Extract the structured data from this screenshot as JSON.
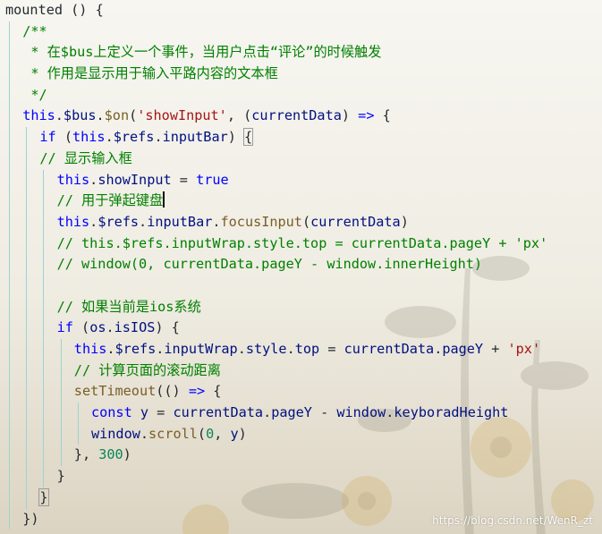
{
  "editor": {
    "theme": {
      "keyword": "#0000ff",
      "function": "#795e26",
      "string": "#a31515",
      "number": "#098658",
      "property": "#001080",
      "comment": "#008000",
      "text": "#24292e",
      "indent_guide": "#9dd3d2"
    },
    "cursor_line": 9,
    "lines": [
      {
        "indent": 0,
        "tokens": [
          [
            "plain",
            "mounted () {"
          ]
        ]
      },
      {
        "indent": 1,
        "tokens": [
          [
            "com",
            "/**"
          ]
        ]
      },
      {
        "indent": 1,
        "tokens": [
          [
            "com",
            " * 在$bus上定义一个事件，当用户点击“评论”的时候触发"
          ]
        ]
      },
      {
        "indent": 1,
        "tokens": [
          [
            "com",
            " * 作用是显示用于输入平路内容的文本框"
          ]
        ]
      },
      {
        "indent": 1,
        "tokens": [
          [
            "com",
            " */"
          ]
        ]
      },
      {
        "indent": 1,
        "tokens": [
          [
            "kw",
            "this"
          ],
          [
            "plain",
            "."
          ],
          [
            "prop",
            "$bus"
          ],
          [
            "plain",
            "."
          ],
          [
            "fn",
            "$on"
          ],
          [
            "plain",
            "("
          ],
          [
            "str",
            "'showInput'"
          ],
          [
            "plain",
            ", ("
          ],
          [
            "prop",
            "currentData"
          ],
          [
            "plain",
            ") "
          ],
          [
            "kw",
            "=>"
          ],
          [
            "plain",
            " {"
          ]
        ]
      },
      {
        "indent": 2,
        "tokens": [
          [
            "kw",
            "if"
          ],
          [
            "plain",
            " ("
          ],
          [
            "kw",
            "this"
          ],
          [
            "plain",
            "."
          ],
          [
            "prop",
            "$refs"
          ],
          [
            "plain",
            "."
          ],
          [
            "prop",
            "inputBar"
          ],
          [
            "plain",
            ") "
          ],
          [
            "box",
            "{"
          ]
        ]
      },
      {
        "indent": 2,
        "tokens": [
          [
            "com",
            "// 显示输入框"
          ]
        ]
      },
      {
        "indent": 3,
        "tokens": [
          [
            "kw",
            "this"
          ],
          [
            "plain",
            "."
          ],
          [
            "prop",
            "showInput"
          ],
          [
            "plain",
            " = "
          ],
          [
            "kw",
            "true"
          ]
        ]
      },
      {
        "indent": 3,
        "tokens": [
          [
            "com",
            "// 用于弹起键盘"
          ],
          [
            "cursor",
            ""
          ]
        ]
      },
      {
        "indent": 3,
        "tokens": [
          [
            "kw",
            "this"
          ],
          [
            "plain",
            "."
          ],
          [
            "prop",
            "$refs"
          ],
          [
            "plain",
            "."
          ],
          [
            "prop",
            "inputBar"
          ],
          [
            "plain",
            "."
          ],
          [
            "fn",
            "focusInput"
          ],
          [
            "plain",
            "("
          ],
          [
            "prop",
            "currentData"
          ],
          [
            "plain",
            ")"
          ]
        ]
      },
      {
        "indent": 3,
        "tokens": [
          [
            "com",
            "// this.$refs.inputWrap.style.top = currentData.pageY + 'px'"
          ]
        ]
      },
      {
        "indent": 3,
        "tokens": [
          [
            "com",
            "// window(0, currentData.pageY - window.innerHeight)"
          ]
        ]
      },
      {
        "indent": 3,
        "tokens": []
      },
      {
        "indent": 3,
        "tokens": [
          [
            "com",
            "// 如果当前是ios系统"
          ]
        ]
      },
      {
        "indent": 3,
        "tokens": [
          [
            "kw",
            "if"
          ],
          [
            "plain",
            " ("
          ],
          [
            "prop",
            "os"
          ],
          [
            "plain",
            "."
          ],
          [
            "prop",
            "isIOS"
          ],
          [
            "plain",
            ") {"
          ]
        ]
      },
      {
        "indent": 4,
        "tokens": [
          [
            "kw",
            "this"
          ],
          [
            "plain",
            "."
          ],
          [
            "prop",
            "$refs"
          ],
          [
            "plain",
            "."
          ],
          [
            "prop",
            "inputWrap"
          ],
          [
            "plain",
            "."
          ],
          [
            "prop",
            "style"
          ],
          [
            "plain",
            "."
          ],
          [
            "prop",
            "top"
          ],
          [
            "plain",
            " = "
          ],
          [
            "prop",
            "currentData"
          ],
          [
            "plain",
            "."
          ],
          [
            "prop",
            "pageY"
          ],
          [
            "plain",
            " + "
          ],
          [
            "str",
            "'px'"
          ]
        ]
      },
      {
        "indent": 4,
        "tokens": [
          [
            "com",
            "// 计算页面的滚动距离"
          ]
        ]
      },
      {
        "indent": 4,
        "tokens": [
          [
            "fn",
            "setTimeout"
          ],
          [
            "plain",
            "(() "
          ],
          [
            "kw",
            "=>"
          ],
          [
            "plain",
            " {"
          ]
        ]
      },
      {
        "indent": 5,
        "tokens": [
          [
            "kw",
            "const"
          ],
          [
            "plain",
            " "
          ],
          [
            "prop",
            "y"
          ],
          [
            "plain",
            " = "
          ],
          [
            "prop",
            "currentData"
          ],
          [
            "plain",
            "."
          ],
          [
            "prop",
            "pageY"
          ],
          [
            "plain",
            " - "
          ],
          [
            "prop",
            "window"
          ],
          [
            "plain",
            "."
          ],
          [
            "prop",
            "keyboradHeight"
          ]
        ]
      },
      {
        "indent": 5,
        "tokens": [
          [
            "prop",
            "window"
          ],
          [
            "plain",
            "."
          ],
          [
            "fn",
            "scroll"
          ],
          [
            "plain",
            "("
          ],
          [
            "num",
            "0"
          ],
          [
            "plain",
            ", "
          ],
          [
            "prop",
            "y"
          ],
          [
            "plain",
            ")"
          ]
        ]
      },
      {
        "indent": 4,
        "tokens": [
          [
            "plain",
            "}, "
          ],
          [
            "num",
            "300"
          ],
          [
            "plain",
            ")"
          ]
        ]
      },
      {
        "indent": 3,
        "tokens": [
          [
            "plain",
            "}"
          ]
        ]
      },
      {
        "indent": 2,
        "tokens": [
          [
            "box",
            "}"
          ]
        ]
      },
      {
        "indent": 1,
        "tokens": [
          [
            "plain",
            "})"
          ]
        ]
      }
    ]
  },
  "watermark": "https://blog.csdn.net/WenR_zt"
}
